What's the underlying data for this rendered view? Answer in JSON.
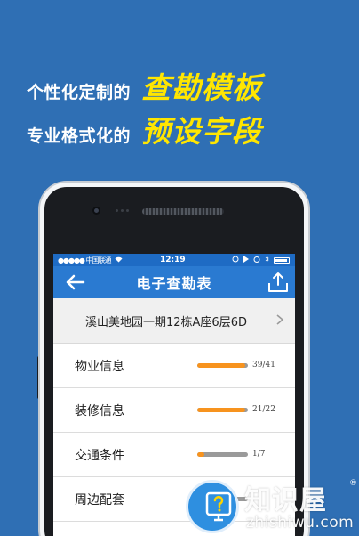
{
  "promo": {
    "line1_small": "个性化定制的",
    "line1_big": "查勘模板",
    "line2_small": "专业格式化的",
    "line2_big": "预设字段"
  },
  "status_bar": {
    "carrier": "●●●●● 中国联通",
    "time": "12:19"
  },
  "navbar": {
    "title": "电子查勘表"
  },
  "address": {
    "text": "溪山美地园一期12栋A座6层6D"
  },
  "rows": [
    {
      "label": "物业信息",
      "count": "39/41",
      "progress": 0.951
    },
    {
      "label": "装修信息",
      "count": "21/22",
      "progress": 0.955
    },
    {
      "label": "交通条件",
      "count": "1/7",
      "progress": 0.143
    },
    {
      "label": "周边配套",
      "count": "",
      "progress": 0.5
    }
  ],
  "watermark": {
    "brand": "知识屋",
    "url": "zhishiwu.com",
    "reg": "®"
  },
  "colors": {
    "background": "#2f6fb4",
    "accent_yellow": "#ffe600",
    "nav_blue": "#2a7ad1",
    "progress_orange": "#f7931e"
  }
}
